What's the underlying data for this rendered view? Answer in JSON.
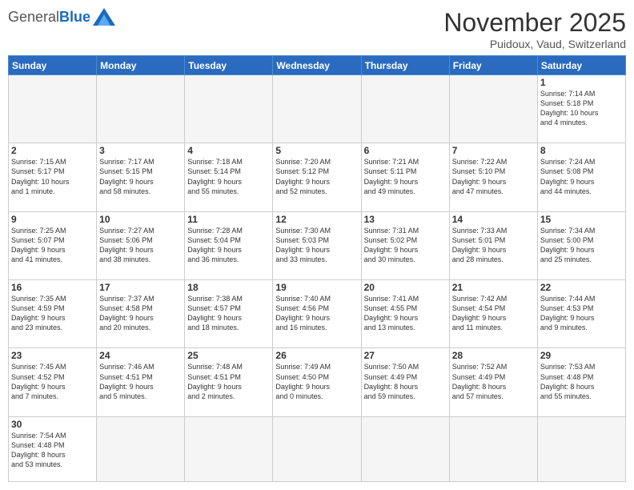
{
  "header": {
    "logo_general": "General",
    "logo_blue": "Blue",
    "month_title": "November 2025",
    "location": "Puidoux, Vaud, Switzerland"
  },
  "days_of_week": [
    "Sunday",
    "Monday",
    "Tuesday",
    "Wednesday",
    "Thursday",
    "Friday",
    "Saturday"
  ],
  "weeks": [
    [
      {
        "day": "",
        "info": ""
      },
      {
        "day": "",
        "info": ""
      },
      {
        "day": "",
        "info": ""
      },
      {
        "day": "",
        "info": ""
      },
      {
        "day": "",
        "info": ""
      },
      {
        "day": "",
        "info": ""
      },
      {
        "day": "1",
        "info": "Sunrise: 7:14 AM\nSunset: 5:18 PM\nDaylight: 10 hours\nand 4 minutes."
      }
    ],
    [
      {
        "day": "2",
        "info": "Sunrise: 7:15 AM\nSunset: 5:17 PM\nDaylight: 10 hours\nand 1 minute."
      },
      {
        "day": "3",
        "info": "Sunrise: 7:17 AM\nSunset: 5:15 PM\nDaylight: 9 hours\nand 58 minutes."
      },
      {
        "day": "4",
        "info": "Sunrise: 7:18 AM\nSunset: 5:14 PM\nDaylight: 9 hours\nand 55 minutes."
      },
      {
        "day": "5",
        "info": "Sunrise: 7:20 AM\nSunset: 5:12 PM\nDaylight: 9 hours\nand 52 minutes."
      },
      {
        "day": "6",
        "info": "Sunrise: 7:21 AM\nSunset: 5:11 PM\nDaylight: 9 hours\nand 49 minutes."
      },
      {
        "day": "7",
        "info": "Sunrise: 7:22 AM\nSunset: 5:10 PM\nDaylight: 9 hours\nand 47 minutes."
      },
      {
        "day": "8",
        "info": "Sunrise: 7:24 AM\nSunset: 5:08 PM\nDaylight: 9 hours\nand 44 minutes."
      }
    ],
    [
      {
        "day": "9",
        "info": "Sunrise: 7:25 AM\nSunset: 5:07 PM\nDaylight: 9 hours\nand 41 minutes."
      },
      {
        "day": "10",
        "info": "Sunrise: 7:27 AM\nSunset: 5:06 PM\nDaylight: 9 hours\nand 38 minutes."
      },
      {
        "day": "11",
        "info": "Sunrise: 7:28 AM\nSunset: 5:04 PM\nDaylight: 9 hours\nand 36 minutes."
      },
      {
        "day": "12",
        "info": "Sunrise: 7:30 AM\nSunset: 5:03 PM\nDaylight: 9 hours\nand 33 minutes."
      },
      {
        "day": "13",
        "info": "Sunrise: 7:31 AM\nSunset: 5:02 PM\nDaylight: 9 hours\nand 30 minutes."
      },
      {
        "day": "14",
        "info": "Sunrise: 7:33 AM\nSunset: 5:01 PM\nDaylight: 9 hours\nand 28 minutes."
      },
      {
        "day": "15",
        "info": "Sunrise: 7:34 AM\nSunset: 5:00 PM\nDaylight: 9 hours\nand 25 minutes."
      }
    ],
    [
      {
        "day": "16",
        "info": "Sunrise: 7:35 AM\nSunset: 4:59 PM\nDaylight: 9 hours\nand 23 minutes."
      },
      {
        "day": "17",
        "info": "Sunrise: 7:37 AM\nSunset: 4:58 PM\nDaylight: 9 hours\nand 20 minutes."
      },
      {
        "day": "18",
        "info": "Sunrise: 7:38 AM\nSunset: 4:57 PM\nDaylight: 9 hours\nand 18 minutes."
      },
      {
        "day": "19",
        "info": "Sunrise: 7:40 AM\nSunset: 4:56 PM\nDaylight: 9 hours\nand 16 minutes."
      },
      {
        "day": "20",
        "info": "Sunrise: 7:41 AM\nSunset: 4:55 PM\nDaylight: 9 hours\nand 13 minutes."
      },
      {
        "day": "21",
        "info": "Sunrise: 7:42 AM\nSunset: 4:54 PM\nDaylight: 9 hours\nand 11 minutes."
      },
      {
        "day": "22",
        "info": "Sunrise: 7:44 AM\nSunset: 4:53 PM\nDaylight: 9 hours\nand 9 minutes."
      }
    ],
    [
      {
        "day": "23",
        "info": "Sunrise: 7:45 AM\nSunset: 4:52 PM\nDaylight: 9 hours\nand 7 minutes."
      },
      {
        "day": "24",
        "info": "Sunrise: 7:46 AM\nSunset: 4:51 PM\nDaylight: 9 hours\nand 5 minutes."
      },
      {
        "day": "25",
        "info": "Sunrise: 7:48 AM\nSunset: 4:51 PM\nDaylight: 9 hours\nand 2 minutes."
      },
      {
        "day": "26",
        "info": "Sunrise: 7:49 AM\nSunset: 4:50 PM\nDaylight: 9 hours\nand 0 minutes."
      },
      {
        "day": "27",
        "info": "Sunrise: 7:50 AM\nSunset: 4:49 PM\nDaylight: 8 hours\nand 59 minutes."
      },
      {
        "day": "28",
        "info": "Sunrise: 7:52 AM\nSunset: 4:49 PM\nDaylight: 8 hours\nand 57 minutes."
      },
      {
        "day": "29",
        "info": "Sunrise: 7:53 AM\nSunset: 4:48 PM\nDaylight: 8 hours\nand 55 minutes."
      }
    ],
    [
      {
        "day": "30",
        "info": "Sunrise: 7:54 AM\nSunset: 4:48 PM\nDaylight: 8 hours\nand 53 minutes."
      },
      {
        "day": "",
        "info": ""
      },
      {
        "day": "",
        "info": ""
      },
      {
        "day": "",
        "info": ""
      },
      {
        "day": "",
        "info": ""
      },
      {
        "day": "",
        "info": ""
      },
      {
        "day": "",
        "info": ""
      }
    ]
  ]
}
